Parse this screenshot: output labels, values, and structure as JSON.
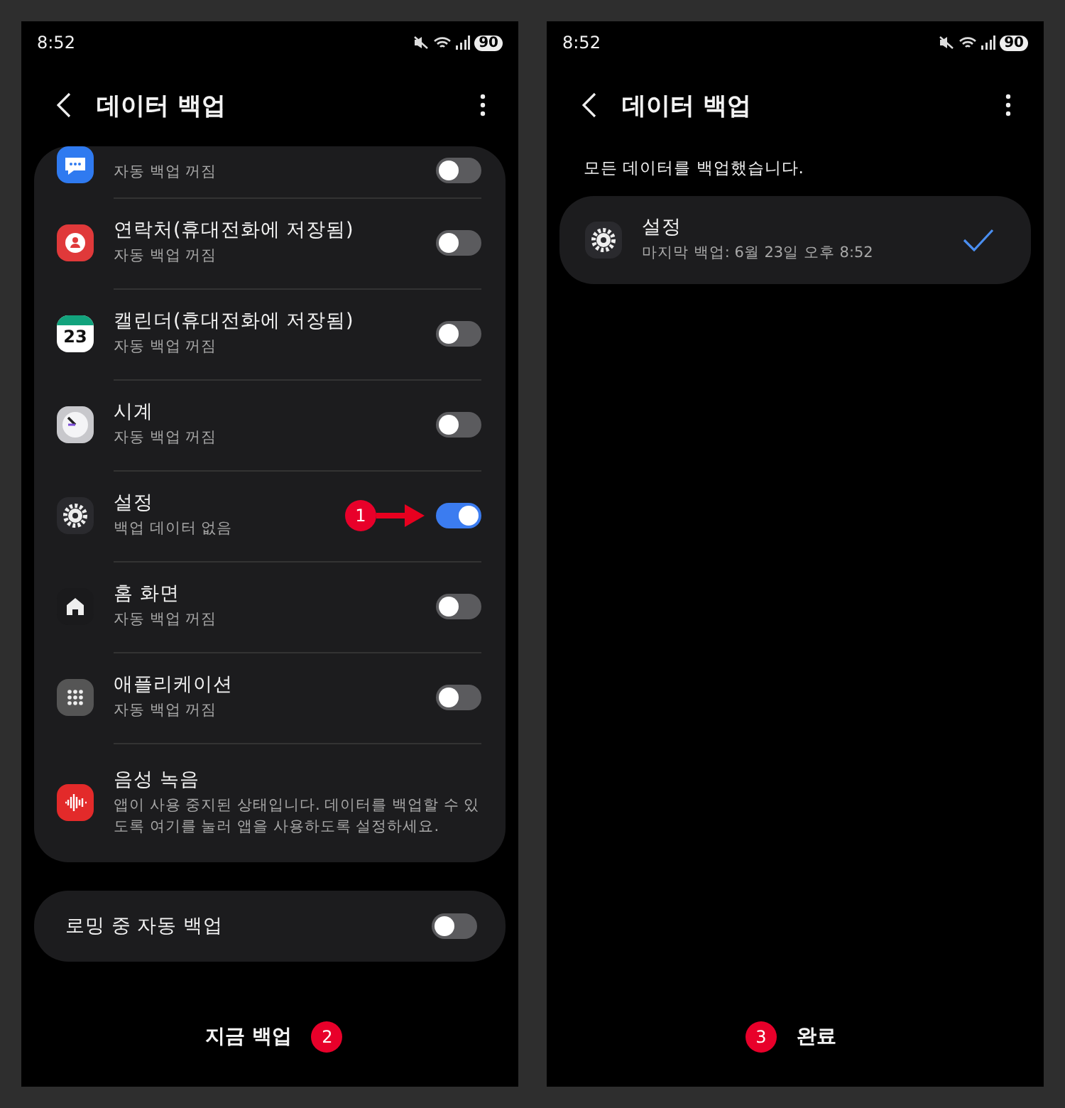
{
  "left": {
    "status": {
      "time": "8:52",
      "battery": "90"
    },
    "title": "데이터 백업",
    "items": [
      {
        "kind": "messages",
        "subtitle": "자동 백업 꺼짐",
        "on": false
      },
      {
        "kind": "contacts",
        "title": "연락처(휴대전화에 저장됨)",
        "subtitle": "자동 백업 꺼짐",
        "on": false
      },
      {
        "kind": "calendar",
        "icon_text": "23",
        "title": "캘린더(휴대전화에 저장됨)",
        "subtitle": "자동 백업 꺼짐",
        "on": false
      },
      {
        "kind": "clock",
        "title": "시계",
        "subtitle": "자동 백업 꺼짐",
        "on": false
      },
      {
        "kind": "settings",
        "title": "설정",
        "subtitle": "백업 데이터 없음",
        "on": true,
        "annotation": "1"
      },
      {
        "kind": "home",
        "title": "홈 화면",
        "subtitle": "자동 백업 꺼짐",
        "on": false
      },
      {
        "kind": "apps",
        "title": "애플리케이션",
        "subtitle": "자동 백업 꺼짐",
        "on": false
      },
      {
        "kind": "voice",
        "title": "음성 녹음",
        "subtitle": "앱이 사용 중지된 상태입니다. 데이터를 백업할 수 있도록 여기를 눌러 앱을 사용하도록 설정하세요."
      }
    ],
    "roaming": {
      "label": "로밍 중 자동 백업",
      "on": false
    },
    "footer": {
      "label": "지금 백업",
      "annotation": "2"
    }
  },
  "right": {
    "status": {
      "time": "8:52",
      "battery": "90"
    },
    "title": "데이터 백업",
    "message": "모든 데이터를 백업했습니다.",
    "result": {
      "kind": "settings",
      "title": "설정",
      "subtitle": "마지막 백업: 6월 23일 오후 8:52",
      "done": true
    },
    "footer": {
      "label": "완료",
      "annotation": "3"
    }
  }
}
